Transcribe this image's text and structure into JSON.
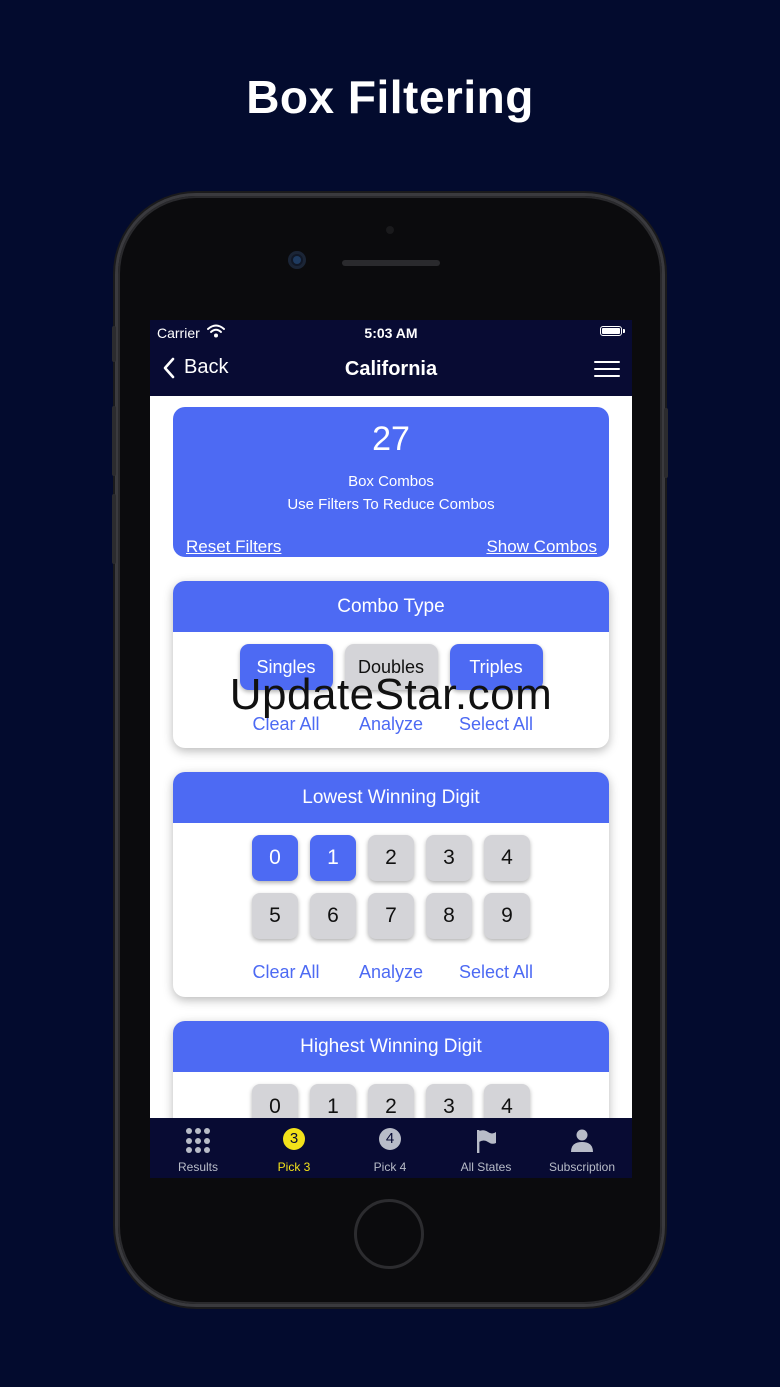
{
  "headline": "Box Filtering",
  "status": {
    "carrier": "Carrier",
    "time": "5:03 AM"
  },
  "nav": {
    "back_label": "Back",
    "title": "California"
  },
  "summary": {
    "count": "27",
    "line1": "Box Combos",
    "line2": "Use Filters To Reduce Combos",
    "reset_label": "Reset Filters",
    "show_label": "Show Combos"
  },
  "combo_type": {
    "title": "Combo Type",
    "options": [
      {
        "label": "Singles",
        "selected": true
      },
      {
        "label": "Doubles",
        "selected": false
      },
      {
        "label": "Triples",
        "selected": true
      }
    ],
    "actions": {
      "clear": "Clear All",
      "analyze": "Analyze",
      "select": "Select All"
    }
  },
  "lowest_digit": {
    "title": "Lowest Winning Digit",
    "row1": [
      {
        "label": "0",
        "selected": true
      },
      {
        "label": "1",
        "selected": true
      },
      {
        "label": "2",
        "selected": false
      },
      {
        "label": "3",
        "selected": false
      },
      {
        "label": "4",
        "selected": false
      }
    ],
    "row2": [
      {
        "label": "5",
        "selected": false
      },
      {
        "label": "6",
        "selected": false
      },
      {
        "label": "7",
        "selected": false
      },
      {
        "label": "8",
        "selected": false
      },
      {
        "label": "9",
        "selected": false
      }
    ],
    "actions": {
      "clear": "Clear All",
      "analyze": "Analyze",
      "select": "Select All"
    }
  },
  "highest_digit": {
    "title": "Highest Winning Digit",
    "row1": [
      {
        "label": "0",
        "selected": false
      },
      {
        "label": "1",
        "selected": false
      },
      {
        "label": "2",
        "selected": false
      },
      {
        "label": "3",
        "selected": false
      },
      {
        "label": "4",
        "selected": false
      }
    ]
  },
  "watermark": "UpdateStar.com",
  "tabs": [
    {
      "label": "Results",
      "icon": "grid-icon",
      "active": false
    },
    {
      "label": "Pick 3",
      "icon": "pick3-icon",
      "badge": "3",
      "active": true
    },
    {
      "label": "Pick 4",
      "icon": "pick4-icon",
      "badge": "4",
      "active": false
    },
    {
      "label": "All States",
      "icon": "flag-icon",
      "active": false
    },
    {
      "label": "Subscription",
      "icon": "person-icon",
      "active": false
    }
  ],
  "colors": {
    "accent": "#4d6af3",
    "navy": "#080b33",
    "active_tab": "#f3e21a",
    "inactive": "#d4d4d8"
  }
}
